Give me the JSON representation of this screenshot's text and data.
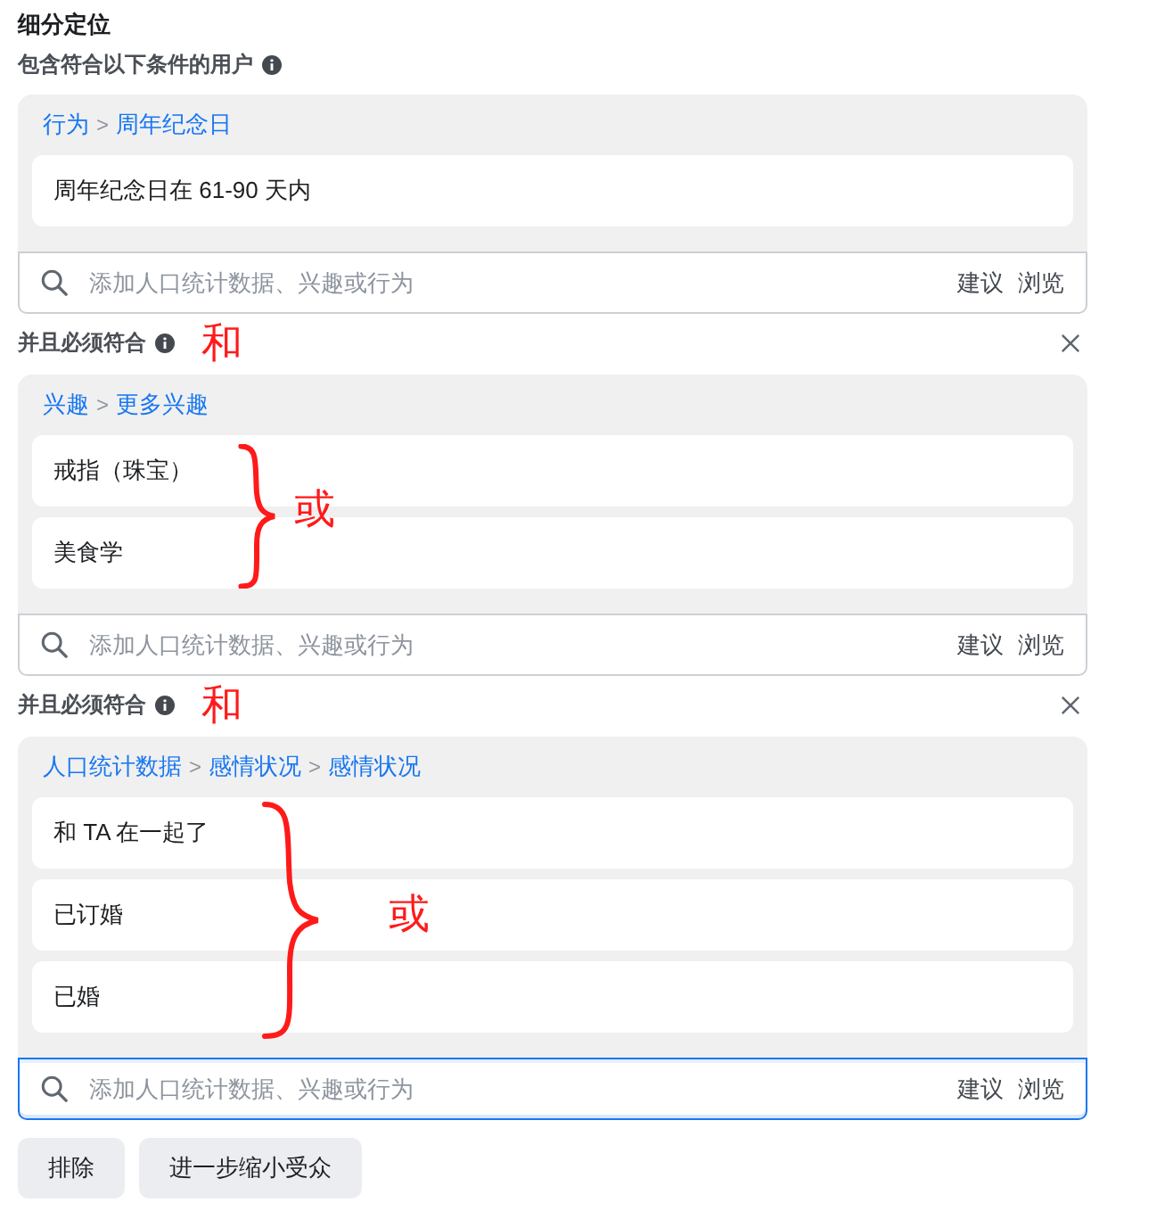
{
  "header": {
    "title": "细分定位"
  },
  "groups": [
    {
      "label": "包含符合以下条件的用户",
      "removable": false,
      "breadcrumb": [
        {
          "kind": "link",
          "text": "行为"
        },
        {
          "kind": "separator",
          "text": ">"
        },
        {
          "kind": "link",
          "text": "周年纪念日"
        }
      ],
      "items": [
        "周年纪念日在 61-90 天内"
      ],
      "search": {
        "placeholder": "添加人口统计数据、兴趣或行为",
        "focused": false,
        "actions": [
          "建议",
          "浏览"
        ]
      }
    },
    {
      "label": "并且必须符合",
      "connector_note": "和",
      "removable": true,
      "breadcrumb": [
        {
          "kind": "link",
          "text": "兴趣"
        },
        {
          "kind": "separator",
          "text": ">"
        },
        {
          "kind": "link",
          "text": "更多兴趣"
        }
      ],
      "items": [
        "戒指（珠宝）",
        "美食学"
      ],
      "items_note": "或",
      "search": {
        "placeholder": "添加人口统计数据、兴趣或行为",
        "focused": false,
        "actions": [
          "建议",
          "浏览"
        ]
      }
    },
    {
      "label": "并且必须符合",
      "connector_note": "和",
      "removable": true,
      "breadcrumb": [
        {
          "kind": "link",
          "text": "人口统计数据"
        },
        {
          "kind": "separator",
          "text": ">"
        },
        {
          "kind": "link",
          "text": "感情状况"
        },
        {
          "kind": "separator",
          "text": ">"
        },
        {
          "kind": "link",
          "text": "感情状况"
        }
      ],
      "items": [
        "和 TA 在一起了",
        "已订婚",
        "已婚"
      ],
      "items_note": "或",
      "search": {
        "placeholder": "添加人口统计数据、兴趣或行为",
        "focused": true,
        "actions": [
          "建议",
          "浏览"
        ]
      }
    }
  ],
  "buttons": [
    "排除",
    "进一步缩小受众"
  ]
}
